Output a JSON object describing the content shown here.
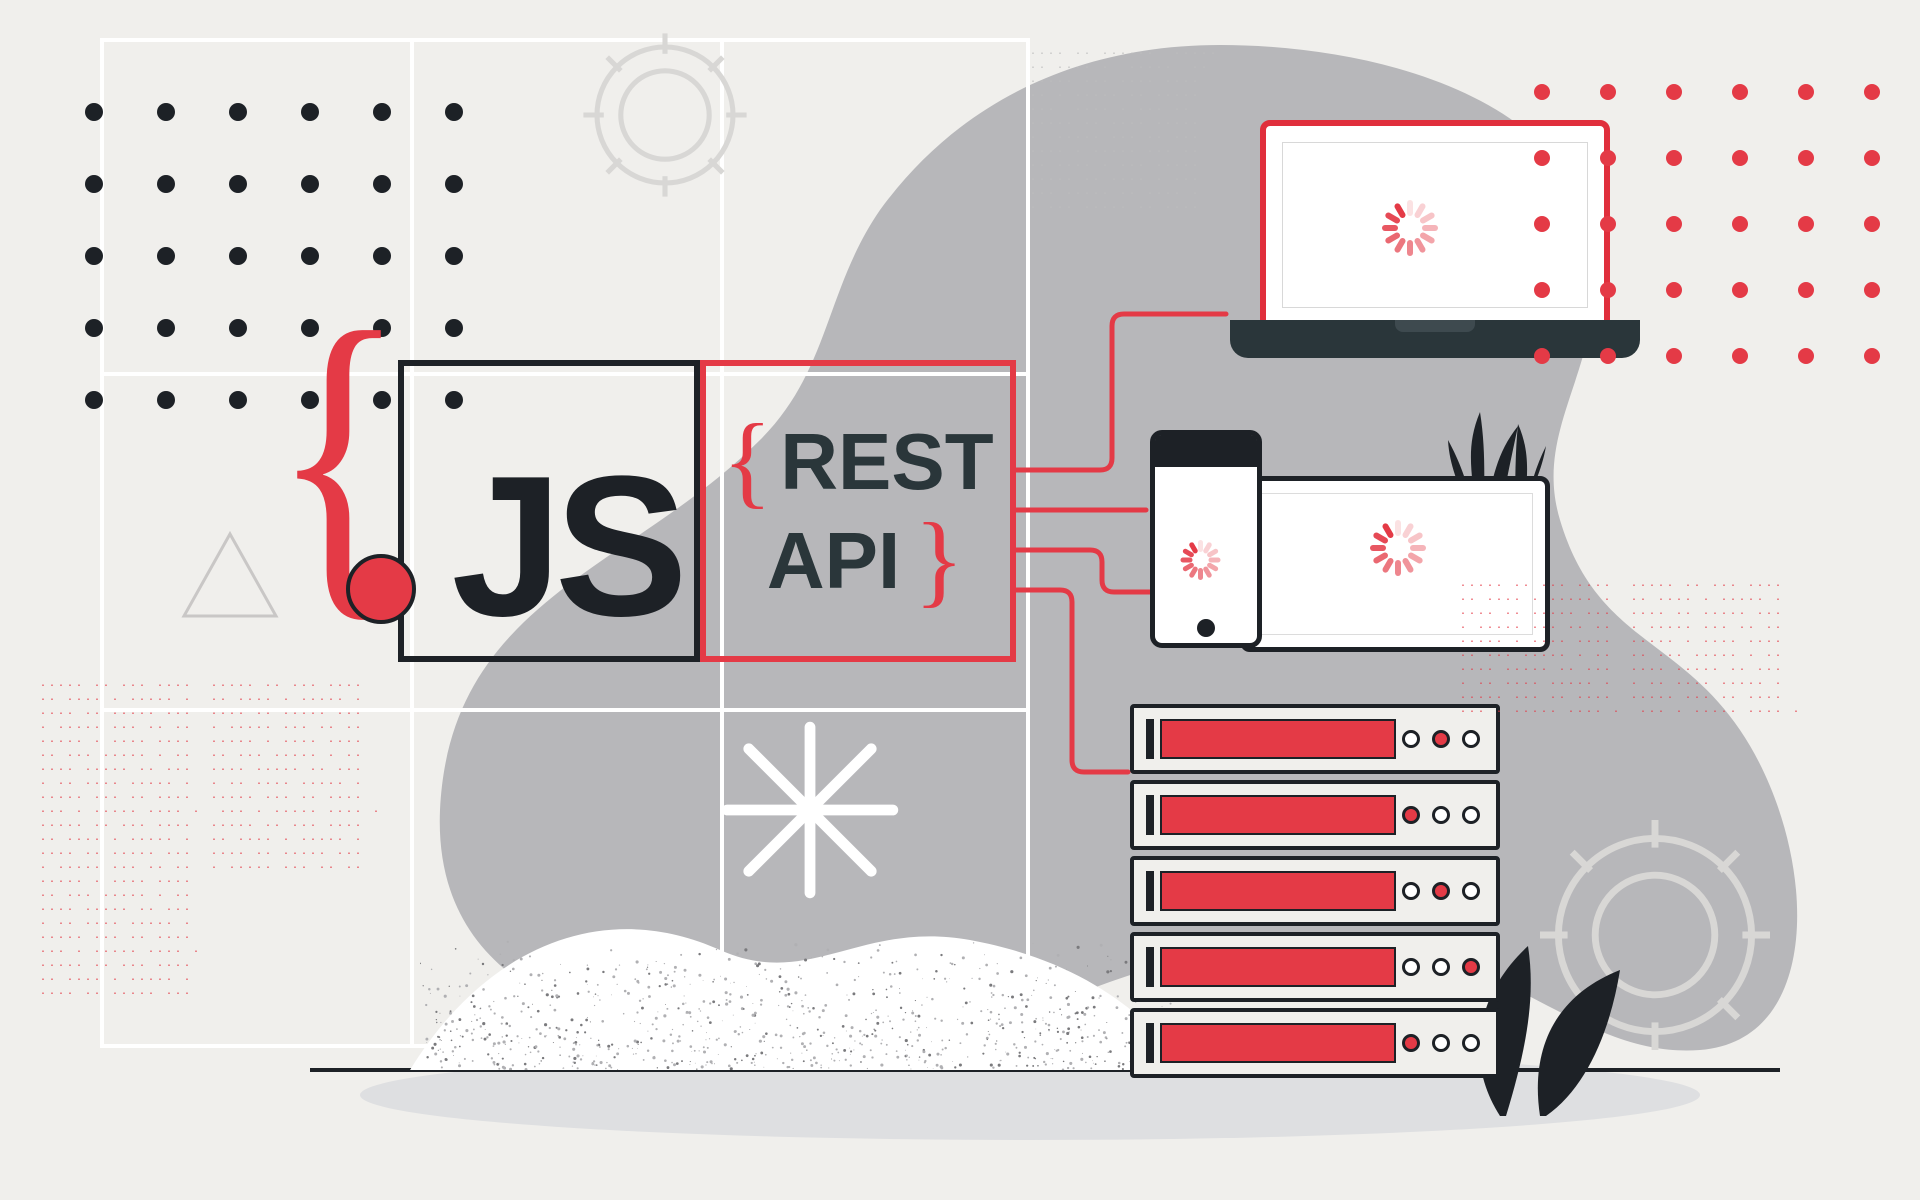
{
  "main": {
    "js_label": "JS",
    "rest_line1": "REST",
    "rest_line2": "API",
    "brace_open": "{",
    "brace_close": "}"
  },
  "colors": {
    "accent": "#e43a46",
    "ink": "#1d2126",
    "bg": "#f0efec",
    "blob": "#b7b7ba"
  },
  "devices": {
    "laptop": "laptop",
    "phone": "phone",
    "tablet": "tablet",
    "server_racks": 5
  }
}
